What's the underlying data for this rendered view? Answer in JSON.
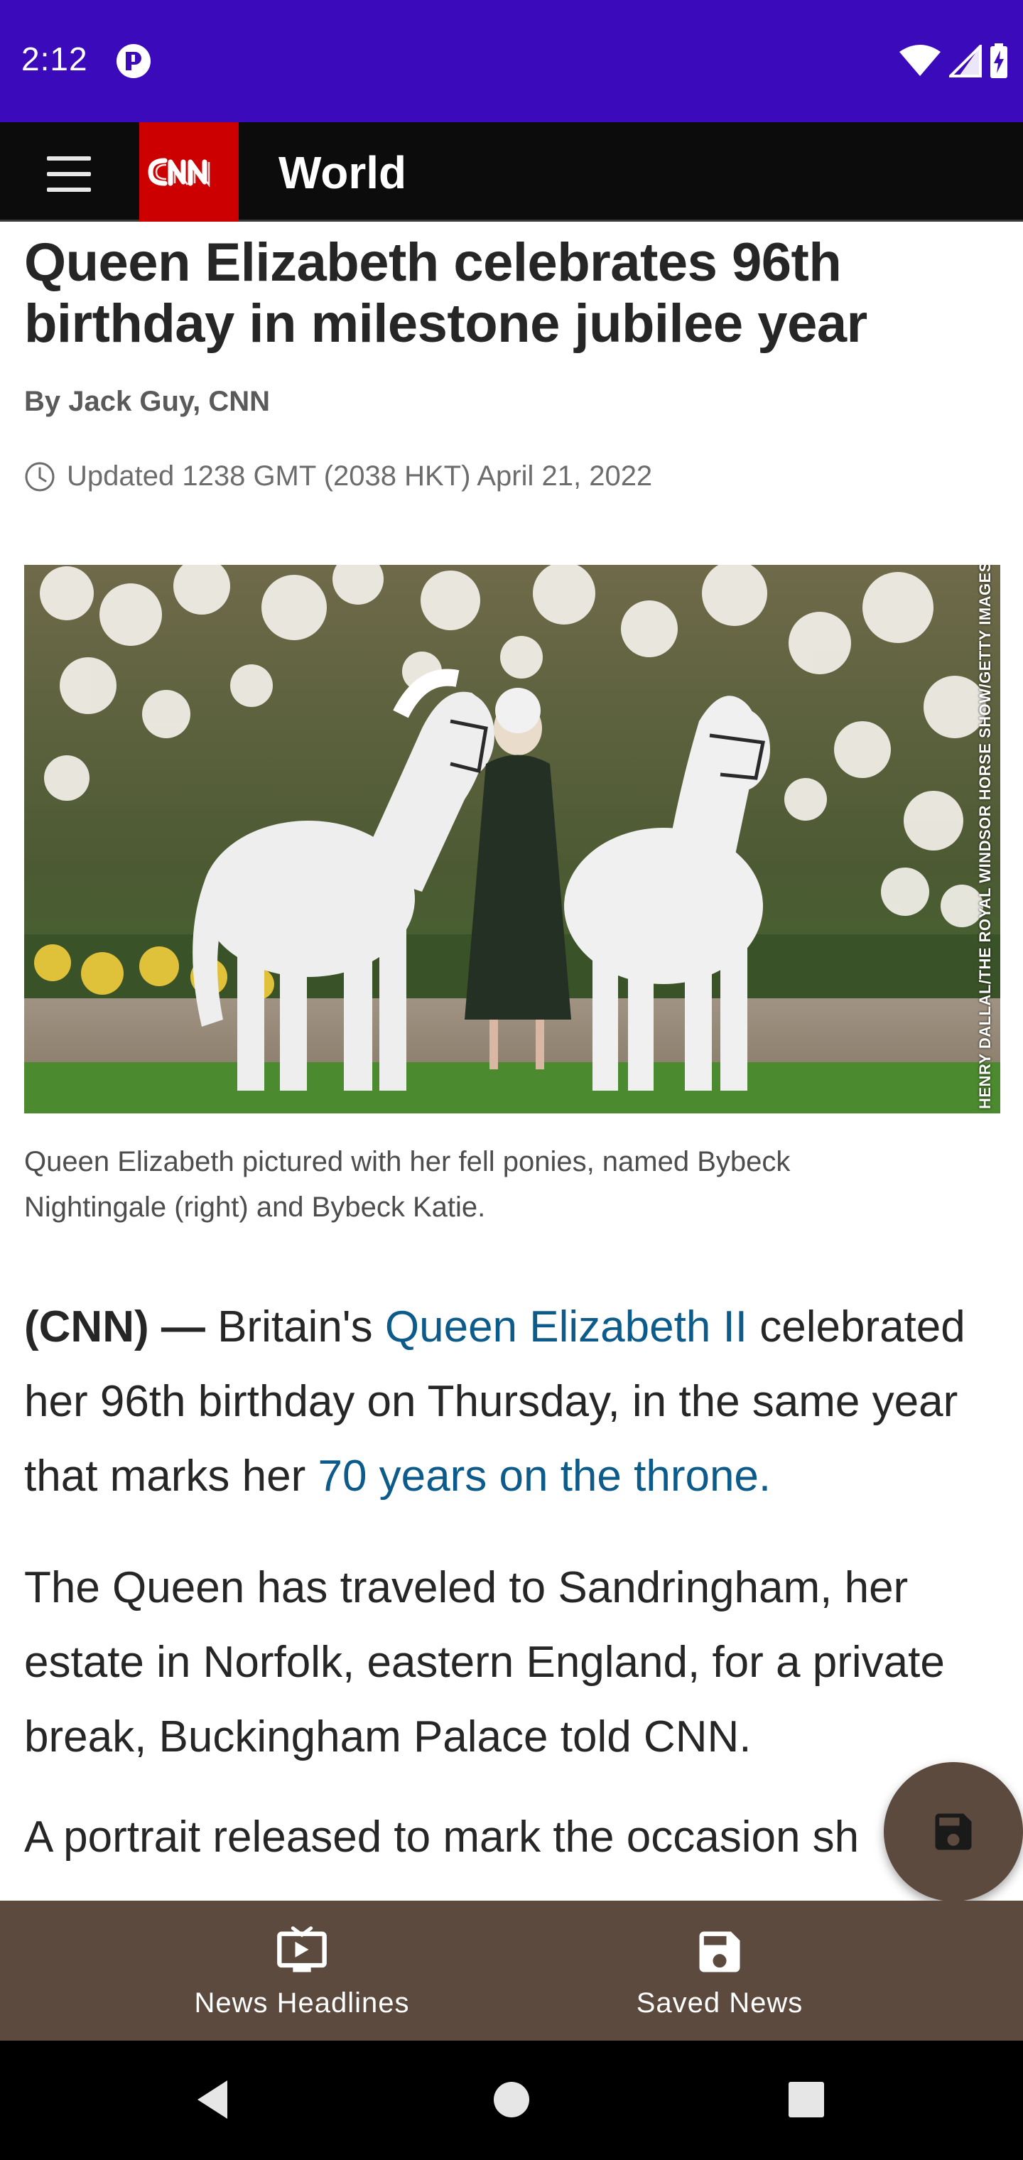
{
  "status_bar": {
    "time": "2:12",
    "background_color": "#3b0aba",
    "icons": [
      "app-notification-icon",
      "wifi-icon",
      "cell-signal-icon",
      "battery-charging-icon"
    ]
  },
  "app_bar": {
    "logo_text": "CNN",
    "logo_color": "#cc0000",
    "title": "World",
    "menu_icon": "hamburger-menu-icon"
  },
  "article": {
    "headline": "Queen Elizabeth celebrates 96th birthday in milestone jubilee year",
    "byline": "By Jack Guy, CNN",
    "updated": "Updated 1238 GMT (2038 HKT) April 21, 2022",
    "photo_credit": "HENRY DALLAL/THE ROYAL WINDSOR HORSE SHOW/GETTY IMAGES",
    "caption": "Queen Elizabeth pictured with her fell ponies, named Bybeck Nightingale (right) and Bybeck Katie.",
    "paragraph_1": {
      "lead": "(CNN) —",
      "text_a": " Britain's ",
      "link_1": "Queen Elizabeth II",
      "text_b": " celebrated her 96th birthday on Thursday, in the same year that marks her ",
      "link_2": "70 years on the throne."
    },
    "paragraph_2": "The Queen has traveled to Sandringham, her estate in Norfolk, eastern England, for a private break, Buckingham Palace told CNN.",
    "paragraph_3": "A portrait released to mark the occasion sh",
    "link_color": "#0c5b8a"
  },
  "fab": {
    "icon": "save-icon"
  },
  "bottom_nav": {
    "background_color": "#5c4a3e",
    "items": [
      {
        "label": "News Headlines",
        "icon": "tv-play-icon"
      },
      {
        "label": "Saved News",
        "icon": "save-icon"
      }
    ]
  },
  "system_nav": {
    "buttons": [
      "back-icon",
      "home-icon",
      "recents-icon"
    ]
  }
}
